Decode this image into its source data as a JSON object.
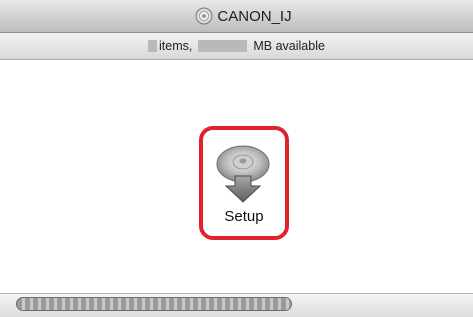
{
  "window": {
    "title": "CANON_IJ",
    "title_icon": "disc-icon"
  },
  "status": {
    "items_suffix": " items,",
    "mb_suffix": " MB available"
  },
  "main": {
    "items": [
      {
        "label": "Setup",
        "icon": "setup-installer-icon",
        "highlight_color": "#e0222e"
      }
    ]
  },
  "scrollbar": {
    "position": 0.0
  }
}
